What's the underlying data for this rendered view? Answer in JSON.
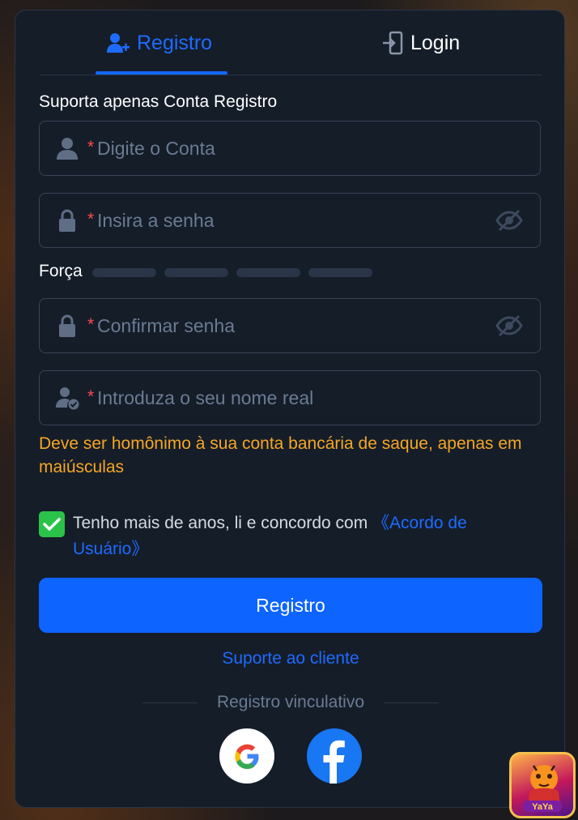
{
  "tabs": {
    "register_label": "Registro",
    "login_label": "Login"
  },
  "notice": "Suporta apenas Conta Registro",
  "fields": {
    "account": {
      "required_mark": "*",
      "placeholder": "Digite o Conta"
    },
    "password": {
      "required_mark": "*",
      "placeholder": "Insira a senha"
    },
    "confirm": {
      "required_mark": "*",
      "placeholder": "Confirmar senha"
    },
    "realname": {
      "required_mark": "*",
      "placeholder": "Introduza o seu nome real"
    }
  },
  "strength": {
    "label": "Força",
    "level": 0,
    "max": 4
  },
  "warning": "Deve ser homônimo à sua conta bancária de saque, apenas em maiúsculas",
  "agreement": {
    "checked": true,
    "text": "Tenho mais de anos, li e concordo com ",
    "link": "《Acordo de Usuário》"
  },
  "submit_label": "Registro",
  "support_label": "Suporte ao cliente",
  "bind_label": "Registro vinculativo",
  "social": [
    "google-icon",
    "facebook-icon"
  ],
  "colors": {
    "accent": "#0d64ff",
    "panel": "#151d29",
    "warning": "#f5a623",
    "check": "#2bc24a",
    "required": "#ff4a4a"
  }
}
